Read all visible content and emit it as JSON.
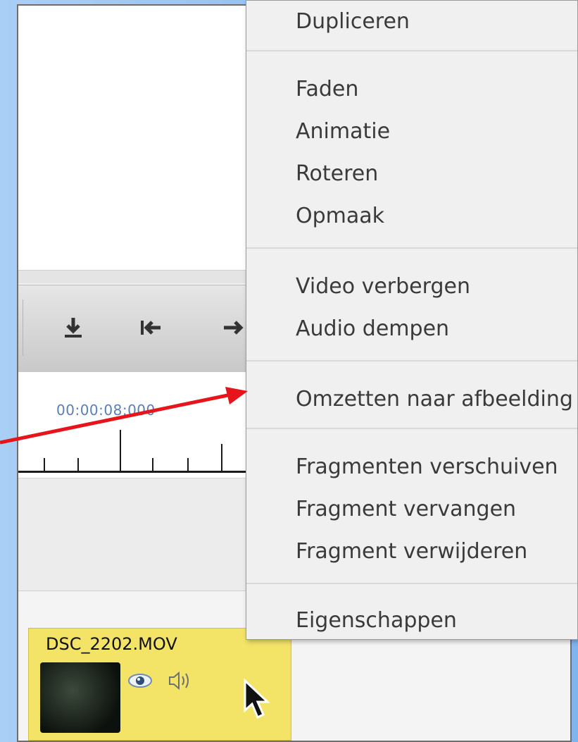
{
  "preview": {},
  "toolbar": {
    "buttons": [
      {
        "icon": "download-icon"
      },
      {
        "icon": "skip-to-start-icon"
      },
      {
        "icon": "arrow-right-icon"
      }
    ]
  },
  "timeline": {
    "timecode": "00:00:08:000"
  },
  "clip": {
    "name": "DSC_2202.MOV",
    "color": "#f3e468",
    "icons": [
      "eye-icon",
      "speaker-icon"
    ]
  },
  "context_menu": {
    "items": [
      "Dupliceren",
      "Faden",
      "Animatie",
      "Roteren",
      "Opmaak",
      "Video verbergen",
      "Audio dempen",
      "Omzetten naar afbeelding",
      "Fragmenten verschuiven",
      "Fragment vervangen",
      "Fragment verwijderen",
      "Eigenschappen"
    ]
  },
  "annotation": {
    "arrow_color": "#e8141b"
  }
}
